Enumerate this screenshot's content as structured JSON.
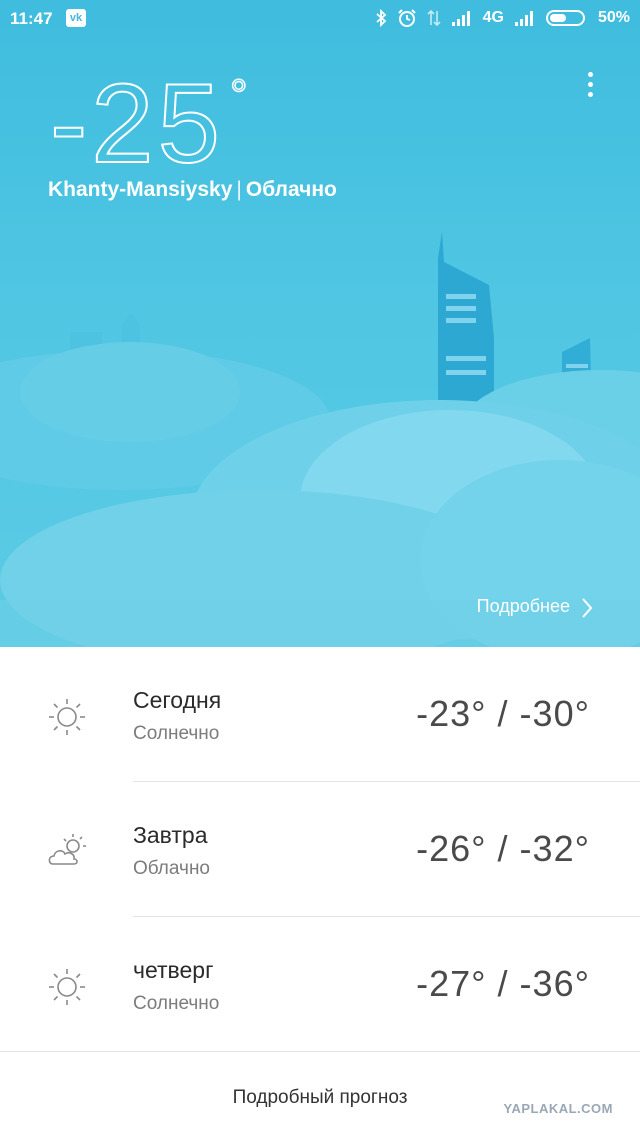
{
  "status_bar": {
    "time": "11:47",
    "network": "4G",
    "battery": "50%"
  },
  "current": {
    "temperature": "-25",
    "degree_symbol": "°",
    "city": "Khanty-Mansiysky",
    "separator": "|",
    "condition": "Облачно"
  },
  "details_link": "Подробнее",
  "forecast": [
    {
      "day": "Сегодня",
      "condition": "Солнечно",
      "temps": "-23° / -30°",
      "icon": "sun-icon"
    },
    {
      "day": "Завтра",
      "condition": "Облачно",
      "temps": "-26° / -32°",
      "icon": "cloud-sun-icon"
    },
    {
      "day": "четверг",
      "condition": "Солнечно",
      "temps": "-27° / -36°",
      "icon": "sun-icon"
    }
  ],
  "detailed_forecast_label": "Подробный прогноз",
  "watermark": "YAPLAKAL.COM",
  "colors": {
    "sky_top": "#3fbcde",
    "sky_bottom": "#5ccbe5",
    "building": "#2ca8d3",
    "cloud": "#8ad9ef"
  }
}
